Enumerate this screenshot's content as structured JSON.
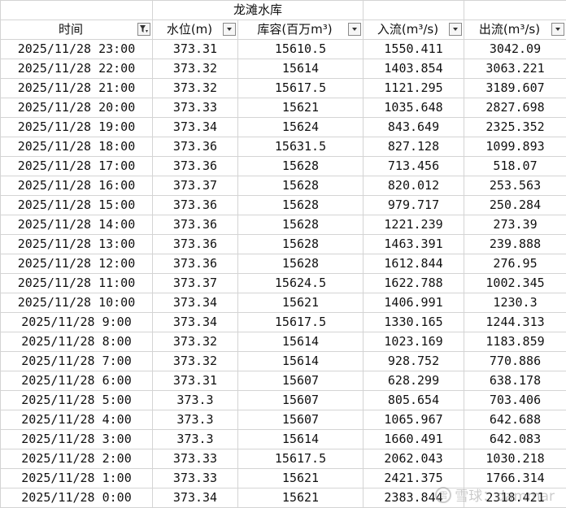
{
  "header": {
    "group_title": "龙滩水库",
    "columns": [
      "时间",
      "水位(m)",
      "库容(百万m³)",
      "入流(m³/s)",
      "出流(m³/s)"
    ],
    "time_filter_active": true
  },
  "rows": [
    [
      "2025/11/28 23:00",
      "373.31",
      "15610.5",
      "1550.411",
      "3042.09"
    ],
    [
      "2025/11/28 22:00",
      "373.32",
      "15614",
      "1403.854",
      "3063.221"
    ],
    [
      "2025/11/28 21:00",
      "373.32",
      "15617.5",
      "1121.295",
      "3189.607"
    ],
    [
      "2025/11/28 20:00",
      "373.33",
      "15621",
      "1035.648",
      "2827.698"
    ],
    [
      "2025/11/28 19:00",
      "373.34",
      "15624",
      "843.649",
      "2325.352"
    ],
    [
      "2025/11/28 18:00",
      "373.36",
      "15631.5",
      "827.128",
      "1099.893"
    ],
    [
      "2025/11/28 17:00",
      "373.36",
      "15628",
      "713.456",
      "518.07"
    ],
    [
      "2025/11/28 16:00",
      "373.37",
      "15628",
      "820.012",
      "253.563"
    ],
    [
      "2025/11/28 15:00",
      "373.36",
      "15628",
      "979.717",
      "250.284"
    ],
    [
      "2025/11/28 14:00",
      "373.36",
      "15628",
      "1221.239",
      "273.39"
    ],
    [
      "2025/11/28 13:00",
      "373.36",
      "15628",
      "1463.391",
      "239.888"
    ],
    [
      "2025/11/28 12:00",
      "373.36",
      "15628",
      "1612.844",
      "276.95"
    ],
    [
      "2025/11/28 11:00",
      "373.37",
      "15624.5",
      "1622.788",
      "1002.345"
    ],
    [
      "2025/11/28 10:00",
      "373.34",
      "15621",
      "1406.991",
      "1230.3"
    ],
    [
      "2025/11/28  9:00",
      "373.34",
      "15617.5",
      "1330.165",
      "1244.313"
    ],
    [
      "2025/11/28  8:00",
      "373.32",
      "15614",
      "1023.169",
      "1183.859"
    ],
    [
      "2025/11/28  7:00",
      "373.32",
      "15614",
      "928.752",
      "770.886"
    ],
    [
      "2025/11/28  6:00",
      "373.31",
      "15607",
      "628.299",
      "638.178"
    ],
    [
      "2025/11/28  5:00",
      "373.3",
      "15607",
      "805.654",
      "703.406"
    ],
    [
      "2025/11/28  4:00",
      "373.3",
      "15607",
      "1065.967",
      "642.688"
    ],
    [
      "2025/11/28  3:00",
      "373.3",
      "15614",
      "1660.491",
      "642.083"
    ],
    [
      "2025/11/28  2:00",
      "373.33",
      "15617.5",
      "2062.043",
      "1030.218"
    ],
    [
      "2025/11/28  1:00",
      "373.33",
      "15621",
      "2421.375",
      "1766.314"
    ],
    [
      "2025/11/28  0:00",
      "373.34",
      "15621",
      "2383.844",
      "2318.421"
    ]
  ],
  "watermark": {
    "logo": "雪",
    "text": "雪球：dammar"
  },
  "icons": {
    "filter_active": "filter-funnel-icon",
    "dropdown": "dropdown-arrow-icon"
  },
  "colors": {
    "grid": "#d4d4d4",
    "text": "#111111"
  }
}
